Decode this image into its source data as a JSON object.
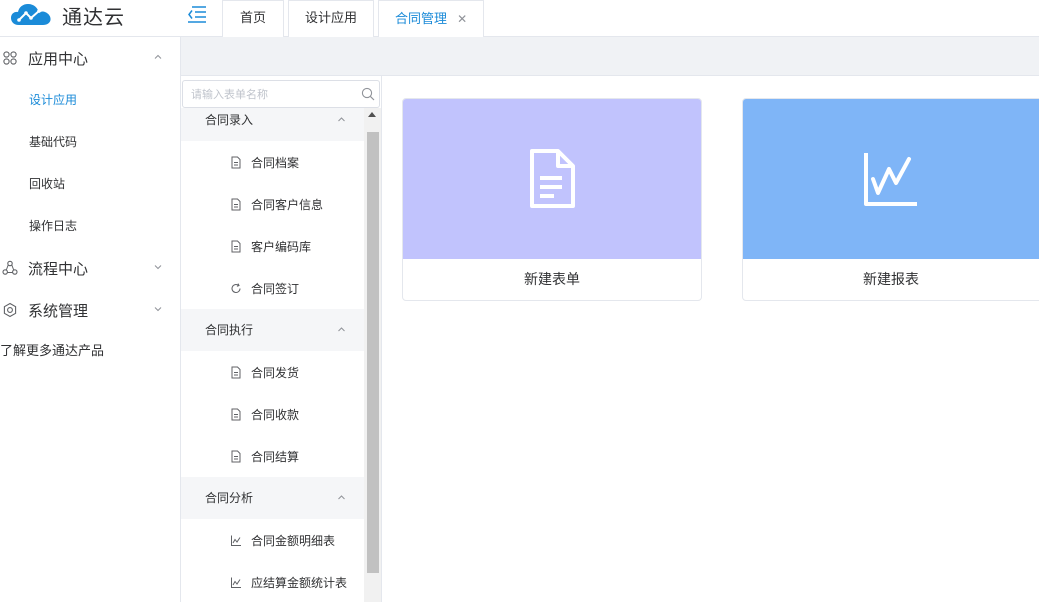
{
  "app": {
    "name": "通达云"
  },
  "tabs": [
    {
      "label": "首页",
      "closable": false,
      "active": false
    },
    {
      "label": "设计应用",
      "closable": false,
      "active": false
    },
    {
      "label": "合同管理",
      "closable": true,
      "active": true
    }
  ],
  "sidebar": {
    "groups": [
      {
        "label": "应用中心",
        "icon": "app-grid-icon",
        "expanded": true,
        "items": [
          {
            "label": "设计应用",
            "active": true
          },
          {
            "label": "基础代码"
          },
          {
            "label": "回收站"
          },
          {
            "label": "操作日志"
          }
        ]
      },
      {
        "label": "流程中心",
        "icon": "workflow-icon",
        "expanded": false
      },
      {
        "label": "系统管理",
        "icon": "settings-icon",
        "expanded": false
      }
    ],
    "more_link": "了解更多通达产品"
  },
  "tree": {
    "search_placeholder": "请输入表单名称",
    "groups": [
      {
        "label": "合同录入",
        "items": [
          {
            "label": "合同档案",
            "icon": "document-icon"
          },
          {
            "label": "合同客户信息",
            "icon": "document-icon"
          },
          {
            "label": "客户编码库",
            "icon": "document-icon"
          },
          {
            "label": "合同签订",
            "icon": "refresh-icon"
          }
        ]
      },
      {
        "label": "合同执行",
        "items": [
          {
            "label": "合同发货",
            "icon": "document-icon"
          },
          {
            "label": "合同收款",
            "icon": "document-icon"
          },
          {
            "label": "合同结算",
            "icon": "document-icon"
          }
        ]
      },
      {
        "label": "合同分析",
        "items": [
          {
            "label": "合同金额明细表",
            "icon": "chart-icon"
          },
          {
            "label": "应结算金额统计表",
            "icon": "chart-icon"
          }
        ]
      }
    ]
  },
  "cards": {
    "new_form": {
      "label": "新建表单",
      "color": "#c1c3fd",
      "icon": "document-icon"
    },
    "new_report": {
      "label": "新建报表",
      "color": "#7fb5f7",
      "icon": "line-chart-icon"
    }
  },
  "colors": {
    "accent": "#1b8bd8"
  }
}
